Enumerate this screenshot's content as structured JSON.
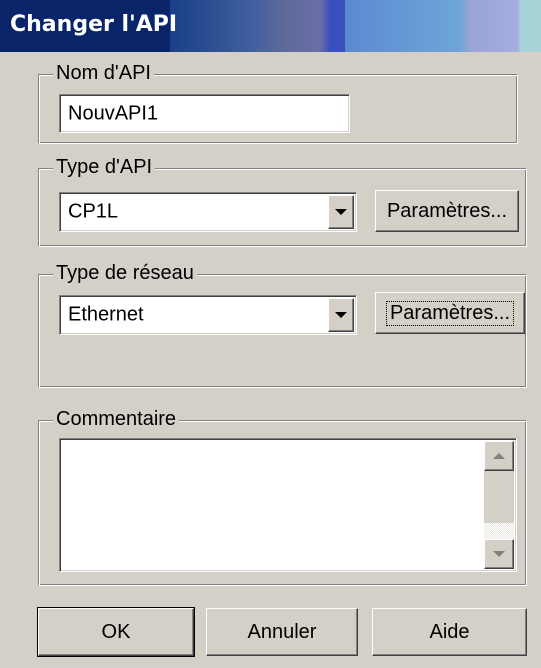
{
  "window": {
    "title": "Changer l'API"
  },
  "plc_name": {
    "group_label": "Nom d'API",
    "value": "NouvAPI1"
  },
  "plc_type": {
    "group_label": "Type d'API",
    "selected": "CP1L",
    "settings_label": "Paramètres..."
  },
  "network_type": {
    "group_label": "Type de réseau",
    "selected": "Ethernet",
    "settings_label": "Paramètres..."
  },
  "comment": {
    "group_label": "Commentaire",
    "value": ""
  },
  "buttons": {
    "ok": "OK",
    "cancel": "Annuler",
    "help": "Aide"
  },
  "icons": {
    "combo": "chevron-down-icon",
    "scroll_up": "scroll-up-arrow-icon",
    "scroll_down": "scroll-down-arrow-icon"
  }
}
